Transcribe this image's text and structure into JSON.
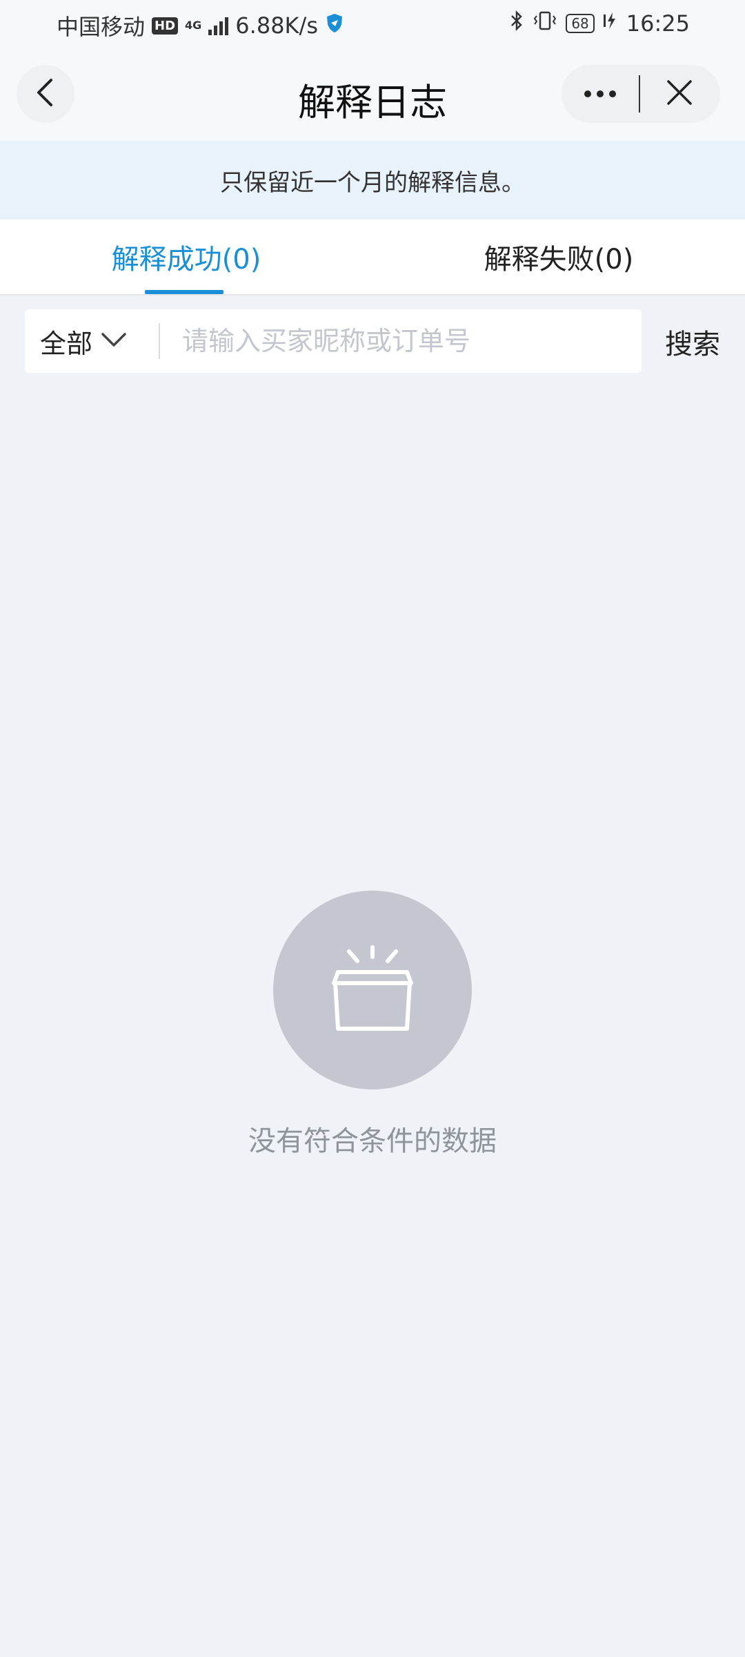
{
  "status_bar": {
    "carrier": "中国移动",
    "hd": "HD",
    "network": "4G",
    "speed": "6.88K/s",
    "battery": "68",
    "time": "16:25"
  },
  "nav": {
    "title": "解释日志",
    "back_icon": "chevron-left-icon",
    "more_icon": "more-dots-icon",
    "close_icon": "close-icon"
  },
  "notice": "只保留近一个月的解释信息。",
  "tabs": [
    {
      "label": "解释成功(0)",
      "active": true
    },
    {
      "label": "解释失败(0)",
      "active": false
    }
  ],
  "search": {
    "filter_label": "全部",
    "placeholder": "请输入买家昵称或订单号",
    "value": "",
    "button_label": "搜索"
  },
  "empty_state": {
    "icon": "empty-box-icon",
    "text": "没有符合条件的数据"
  },
  "colors": {
    "accent": "#1a8fd6",
    "background": "#eff2f6",
    "notice_bg": "#e8f2fb",
    "empty_circle": "#c4c7cf"
  }
}
